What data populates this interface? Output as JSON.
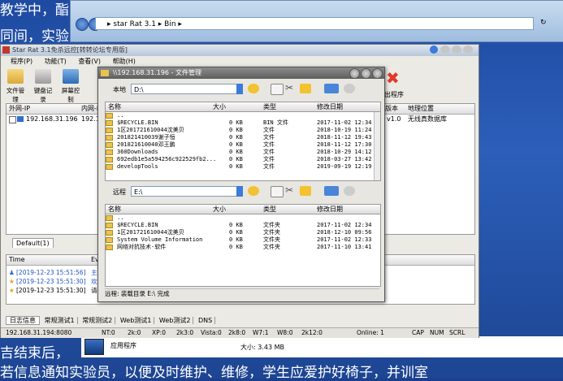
{
  "background": {
    "slide_text_top": "教学中，酯",
    "slide_text_line2": "同间，实验",
    "slide_text_line3": "吉结束后，",
    "slide_text_bottom": "若信息通知实验员，以便及时维护、维修，学生应爱护好椅子，并训室"
  },
  "explorer": {
    "breadcrumb": "▸ star Rat 3.1 ▸ Bin ▸",
    "bottom_item_label": "应用程序",
    "bottom_item_size": "大小: 3.43 MB"
  },
  "app": {
    "title": "Star Rat 3.1免杀远控[转转论坛专用版]",
    "menu": [
      "程序(P)",
      "功能(T)",
      "查看(V)",
      "帮助(H)"
    ],
    "toolbar": [
      "文件管理",
      "键盘记录",
      "屏幕控制"
    ],
    "toolbar_right": "出程序",
    "host_list": {
      "headers": [
        "外网-IP",
        "内网-IP",
        "版本",
        "地理位置"
      ],
      "rows": [
        {
          "ip": "192.168.31.196",
          "lan": "192.16",
          "ver": "v1.0",
          "geo": "无线真数据库"
        }
      ]
    },
    "group_tab": "Default(1)",
    "log": {
      "headers": [
        "Time",
        "Eve"
      ],
      "rows": [
        {
          "time": "[2019-12-23 15:51:56]",
          "event": "主机"
        },
        {
          "time": "[2019-12-23 15:51:30]",
          "event": "欢迎"
        },
        {
          "time": "[2019-12-23 15:51:30]",
          "event": "请各"
        }
      ]
    },
    "bottom_tabs": [
      "日志信息",
      "常规测试1",
      "常规测试2",
      "Web测试1",
      "Web测试2",
      "DNS"
    ],
    "status": {
      "addr": "192.168.31.194:8080",
      "nt": "NT:0",
      "k2": "2k:0",
      "xp": "XP:0",
      "k3": "2k3:0",
      "vista": "Vista:0",
      "k8": "2k8:0",
      "w7": "W7:1",
      "w8": "W8:0",
      "k12": "2k12:0",
      "online": "Online: 1",
      "caps": "CAP",
      "num": "NUM",
      "scrl": "SCRL"
    }
  },
  "file_manager": {
    "title": "\\\\192.168.31.196 - 文件管理",
    "local_label": "本地",
    "local_path": "D:\\",
    "remote_label": "远程",
    "remote_path": "E:\\",
    "headers": [
      "名称",
      "大小",
      "类型",
      "修改日期"
    ],
    "local_files": [
      {
        "name": "..",
        "size": "",
        "type": "",
        "date": ""
      },
      {
        "name": "$RECYCLE.BIN",
        "size": "0 KB",
        "type": "BIN 文件",
        "date": "2017-11-02 12:34"
      },
      {
        "name": "1区2017216100​44沈美贝",
        "size": "0 KB",
        "type": "文件",
        "date": "2018-10-19 11:24"
      },
      {
        "name": "2018214100​39谢子恒",
        "size": "0 KB",
        "type": "文件",
        "date": "2018-11-12 19:43"
      },
      {
        "name": "2018216100​40邓王鹏",
        "size": "0 KB",
        "type": "文件",
        "date": "2018-11-12 17:30"
      },
      {
        "name": "360Downloads",
        "size": "0 KB",
        "type": "文件",
        "date": "2018-10-29 14:12"
      },
      {
        "name": "692edb1e5a594256c922529fb2...",
        "size": "0 KB",
        "type": "文件",
        "date": "2018-03-27 13:42"
      },
      {
        "name": "developTools",
        "size": "0 KB",
        "type": "文件",
        "date": "2019-09-19 12:19"
      }
    ],
    "remote_files": [
      {
        "name": "..",
        "size": "",
        "type": "",
        "date": ""
      },
      {
        "name": "$RECYCLE.BIN",
        "size": "0 KB",
        "type": "文件夹",
        "date": "2017-11-02 12:34"
      },
      {
        "name": "1区2017216100​44沈美贝",
        "size": "0 KB",
        "type": "文件夹",
        "date": "2018-12-10 09:56"
      },
      {
        "name": "System Volume Information",
        "size": "0 KB",
        "type": "文件夹",
        "date": "2017-11-02 12:33"
      },
      {
        "name": "网络对抗技术-软件",
        "size": "0 KB",
        "type": "文件夹",
        "date": "2017-11-10 13:41"
      }
    ],
    "status": "远程: 装载目录 E:\\ 完成"
  }
}
